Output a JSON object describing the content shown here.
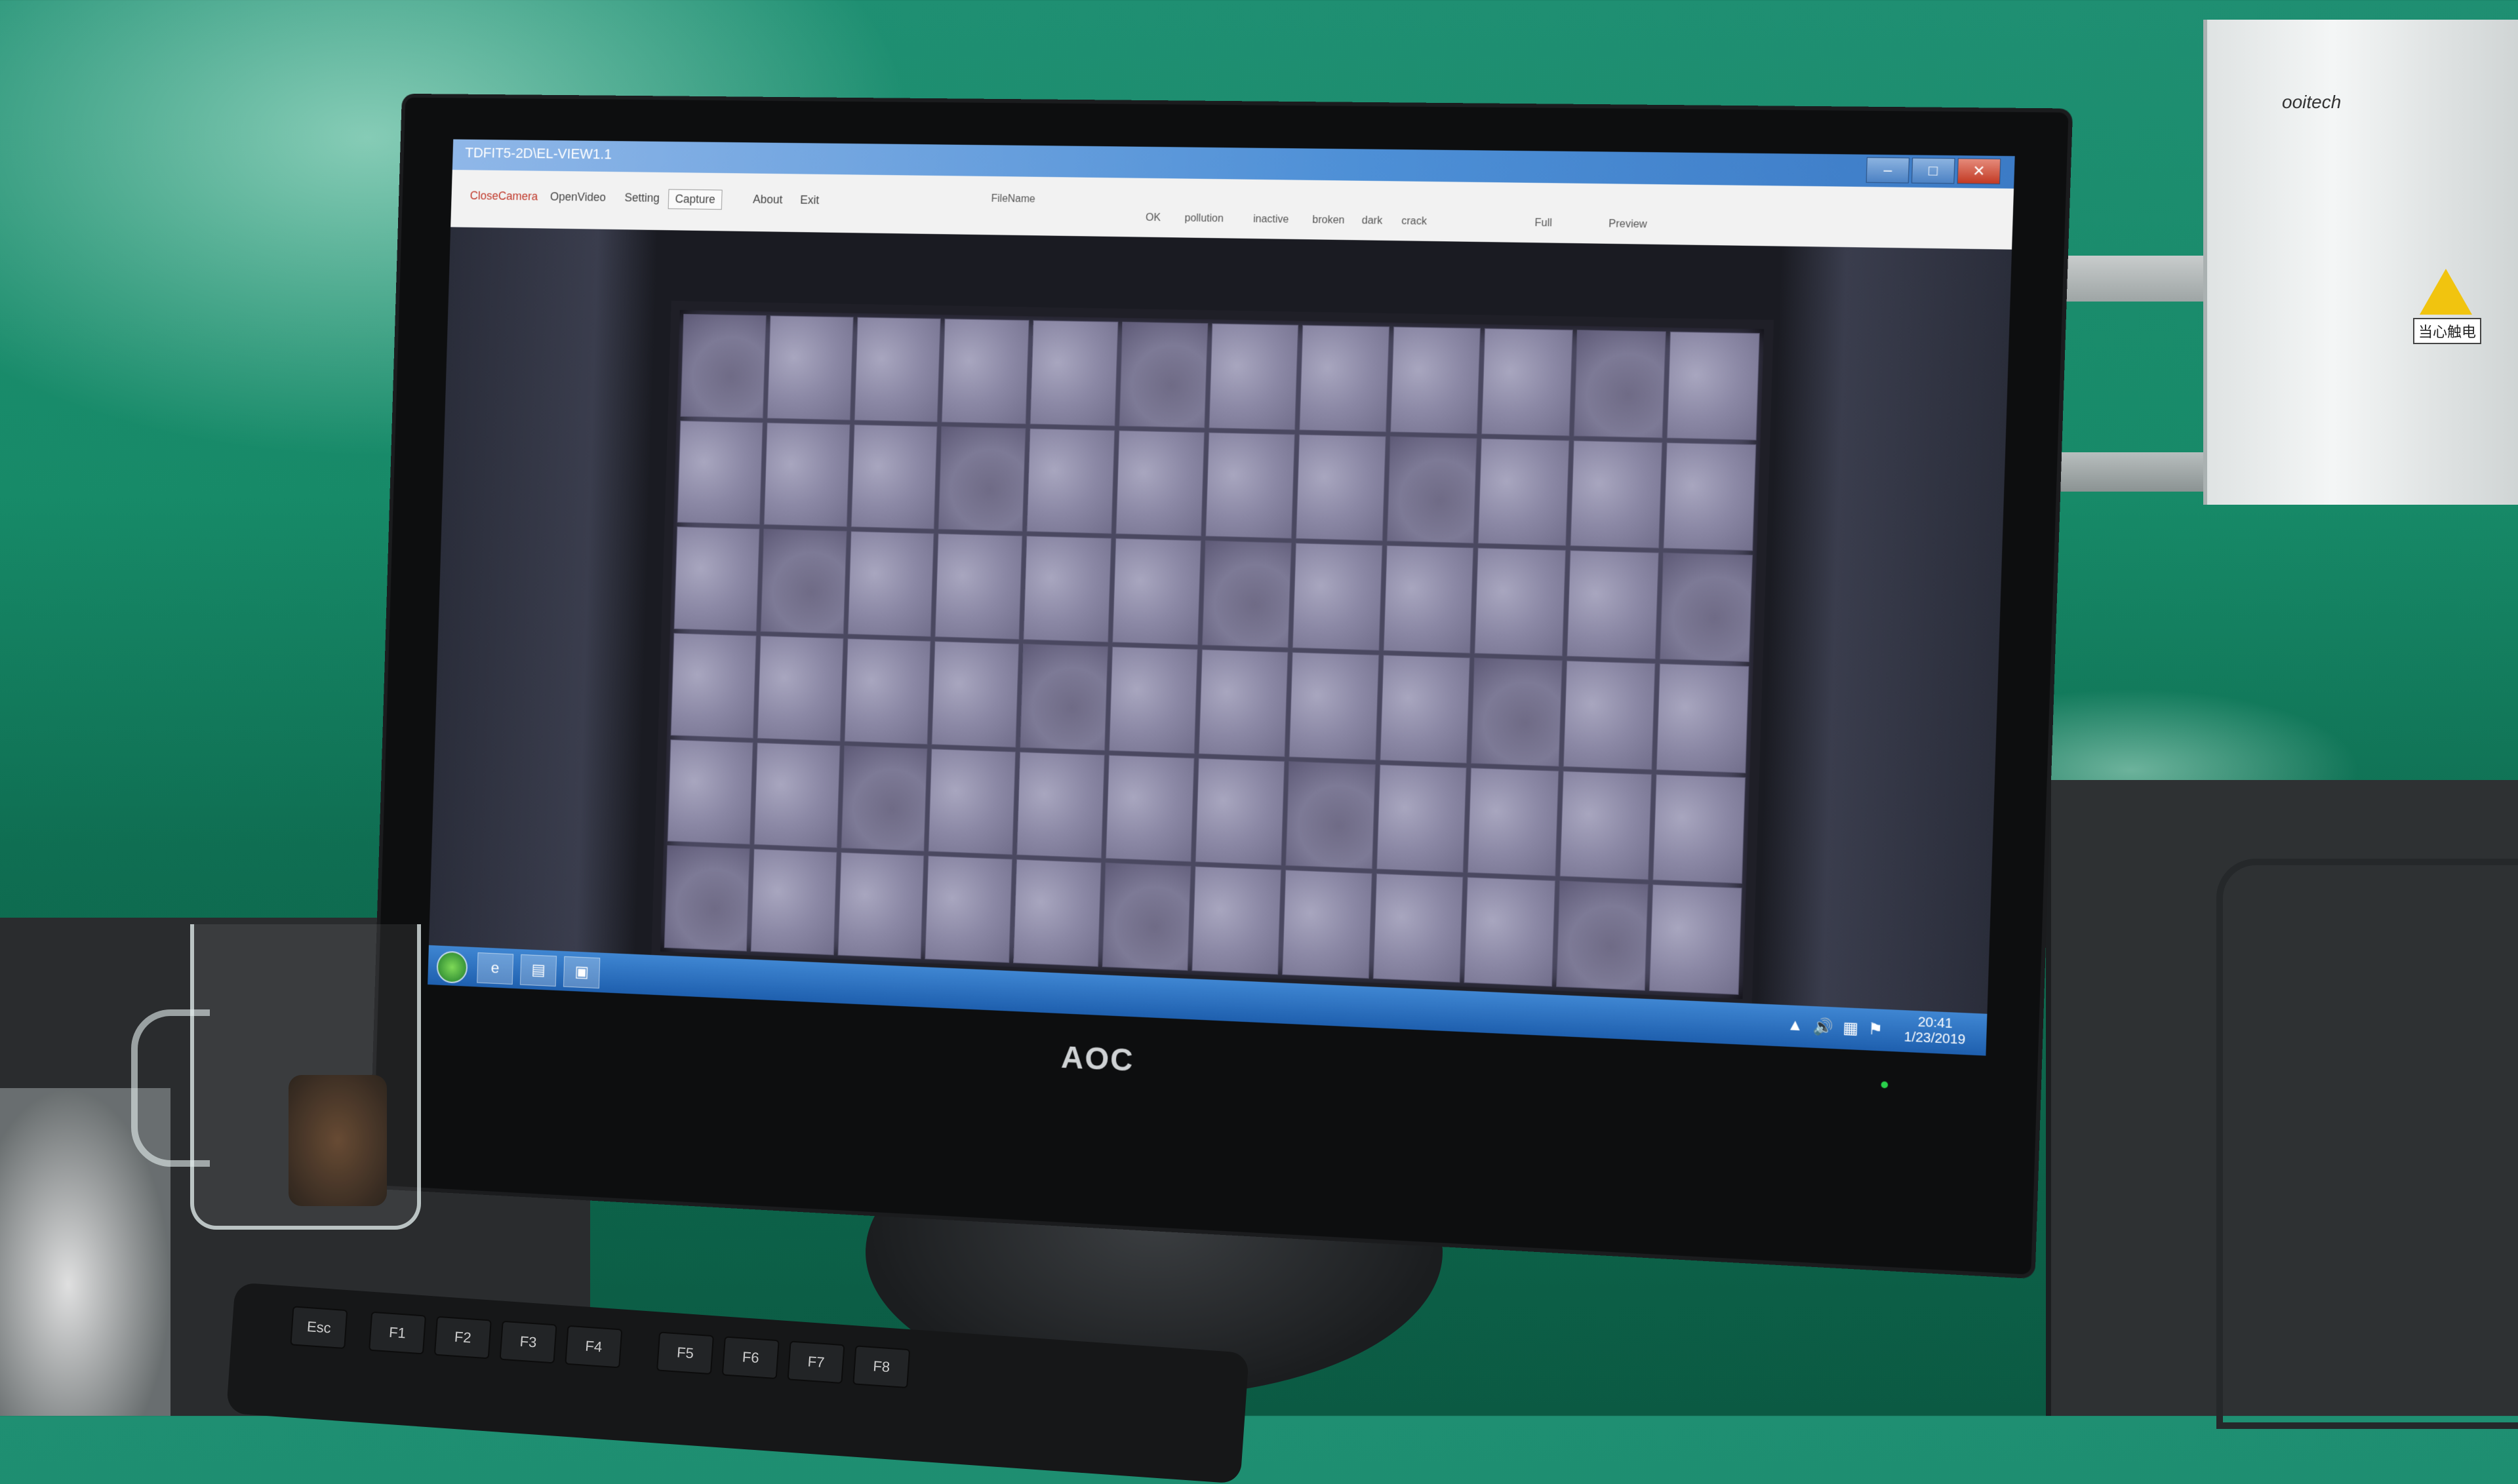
{
  "background": {
    "machine_brand": "ooitech",
    "warning_label": "当心触电"
  },
  "monitor": {
    "brand": "AOC"
  },
  "window": {
    "title": "TDFIT5-2D\\EL-VIEW1.1",
    "buttons": {
      "minimize": "–",
      "maximize": "□",
      "close": "✕"
    }
  },
  "menu": {
    "items": [
      "CloseCamera",
      "OpenVideo",
      "Setting",
      "Capture",
      "About",
      "Exit"
    ],
    "active": "Capture"
  },
  "status": {
    "filename_label": "FileName",
    "ok": "OK",
    "defects": [
      "pollution",
      "inactive",
      "broken",
      "dark",
      "crack"
    ],
    "full": "Full",
    "preview": "Preview"
  },
  "taskbar": {
    "time": "20:41",
    "date": "1/23/2019"
  },
  "keyboard": {
    "keys": [
      "Esc",
      "F1",
      "F2",
      "F3",
      "F4",
      "F5",
      "F6",
      "F7",
      "F8"
    ]
  }
}
